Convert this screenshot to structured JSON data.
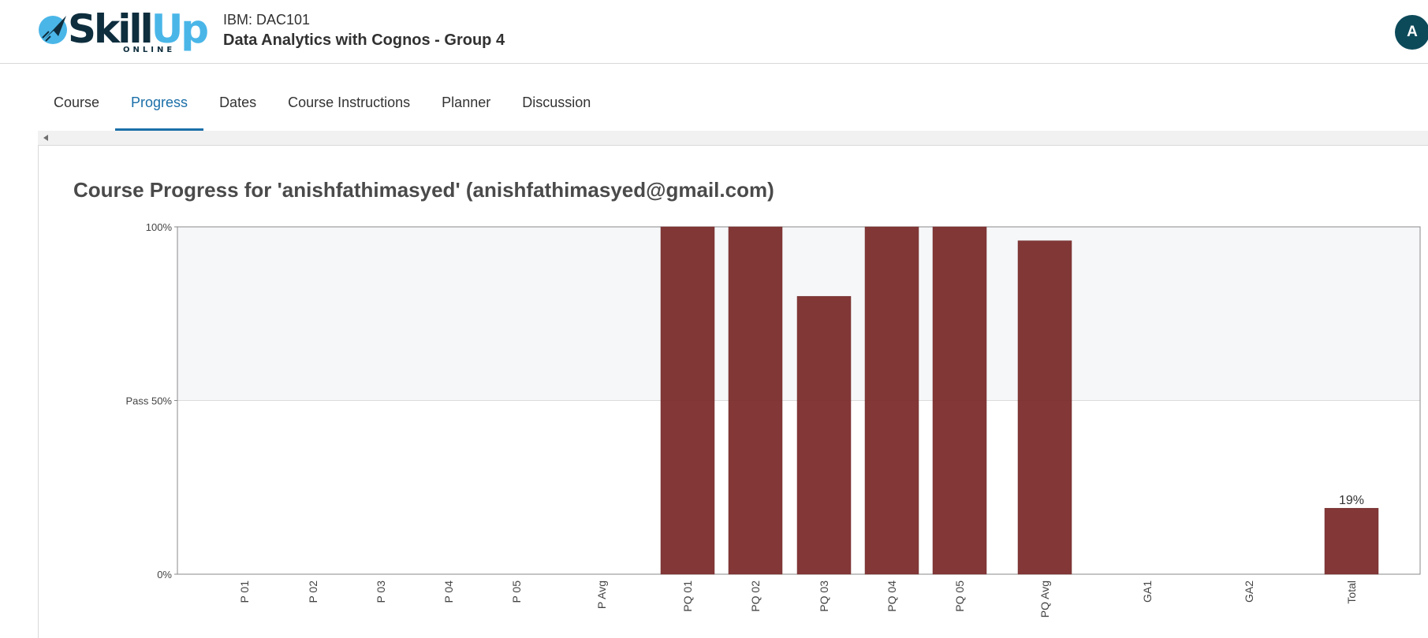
{
  "header": {
    "logo": {
      "text_main": "Skill",
      "text_accent": "Up",
      "text_sub": "ONLINE"
    },
    "course_org": "IBM: DAC101",
    "course_name": "Data Analytics with Cognos - Group 4",
    "avatar_initial": "A"
  },
  "tabs": [
    {
      "label": "Course",
      "active": false
    },
    {
      "label": "Progress",
      "active": true
    },
    {
      "label": "Dates",
      "active": false
    },
    {
      "label": "Course Instructions",
      "active": false
    },
    {
      "label": "Planner",
      "active": false
    },
    {
      "label": "Discussion",
      "active": false
    }
  ],
  "main": {
    "title": "Course Progress for 'anishfathimasyed' (anishfathimasyed@gmail.com)"
  },
  "colors": {
    "accent": "#1b6fa8",
    "bar": "#7f3131",
    "pass_band": "#f6f7f9",
    "avatar": "#0c4a5a"
  },
  "chart_data": {
    "type": "bar",
    "categories": [
      "P 01",
      "P 02",
      "P 03",
      "P 04",
      "P 05",
      "P Avg",
      "PQ 01",
      "PQ 02",
      "PQ 03",
      "PQ 04",
      "PQ 05",
      "PQ Avg",
      "GA1",
      "GA2",
      "Total"
    ],
    "values": [
      0,
      0,
      0,
      0,
      0,
      0,
      100,
      100,
      80,
      100,
      100,
      96,
      0,
      0,
      19
    ],
    "y_ticks": [
      {
        "value": 0,
        "label": "0%"
      },
      {
        "value": 50,
        "label": "Pass 50%"
      },
      {
        "value": 100,
        "label": "100%"
      }
    ],
    "data_labels": [
      {
        "category": "Total",
        "label": "19%"
      }
    ],
    "ylim": [
      0,
      100
    ],
    "pass_threshold": 50,
    "grid": false,
    "legend": "none"
  }
}
